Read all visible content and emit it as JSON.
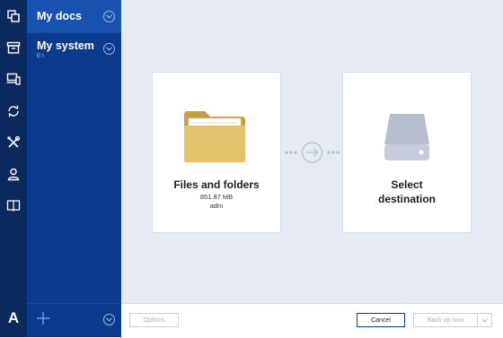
{
  "rail": {
    "icons": [
      "copy-icon",
      "archive-icon",
      "devices-icon",
      "sync-icon",
      "tools-icon",
      "account-icon",
      "book-icon"
    ],
    "logo": "A"
  },
  "backups": {
    "items": [
      {
        "label": "My docs",
        "subtitle": "",
        "selected": true
      },
      {
        "label": "My system",
        "subtitle": "E:\\",
        "selected": false
      }
    ]
  },
  "source": {
    "title": "Files and folders",
    "size": "851.87 MB",
    "user": "adm"
  },
  "destination": {
    "title_line1": "Select",
    "title_line2": "destination"
  },
  "footer": {
    "options_label": "Options",
    "cancel_label": "Cancel",
    "backup_label": "Back up now"
  },
  "colors": {
    "rail": "#0a2a5e",
    "panel": "#0c3a8d",
    "selected": "#1953b0",
    "folder": "#e3c26d",
    "drive": "#b7bfcc"
  }
}
